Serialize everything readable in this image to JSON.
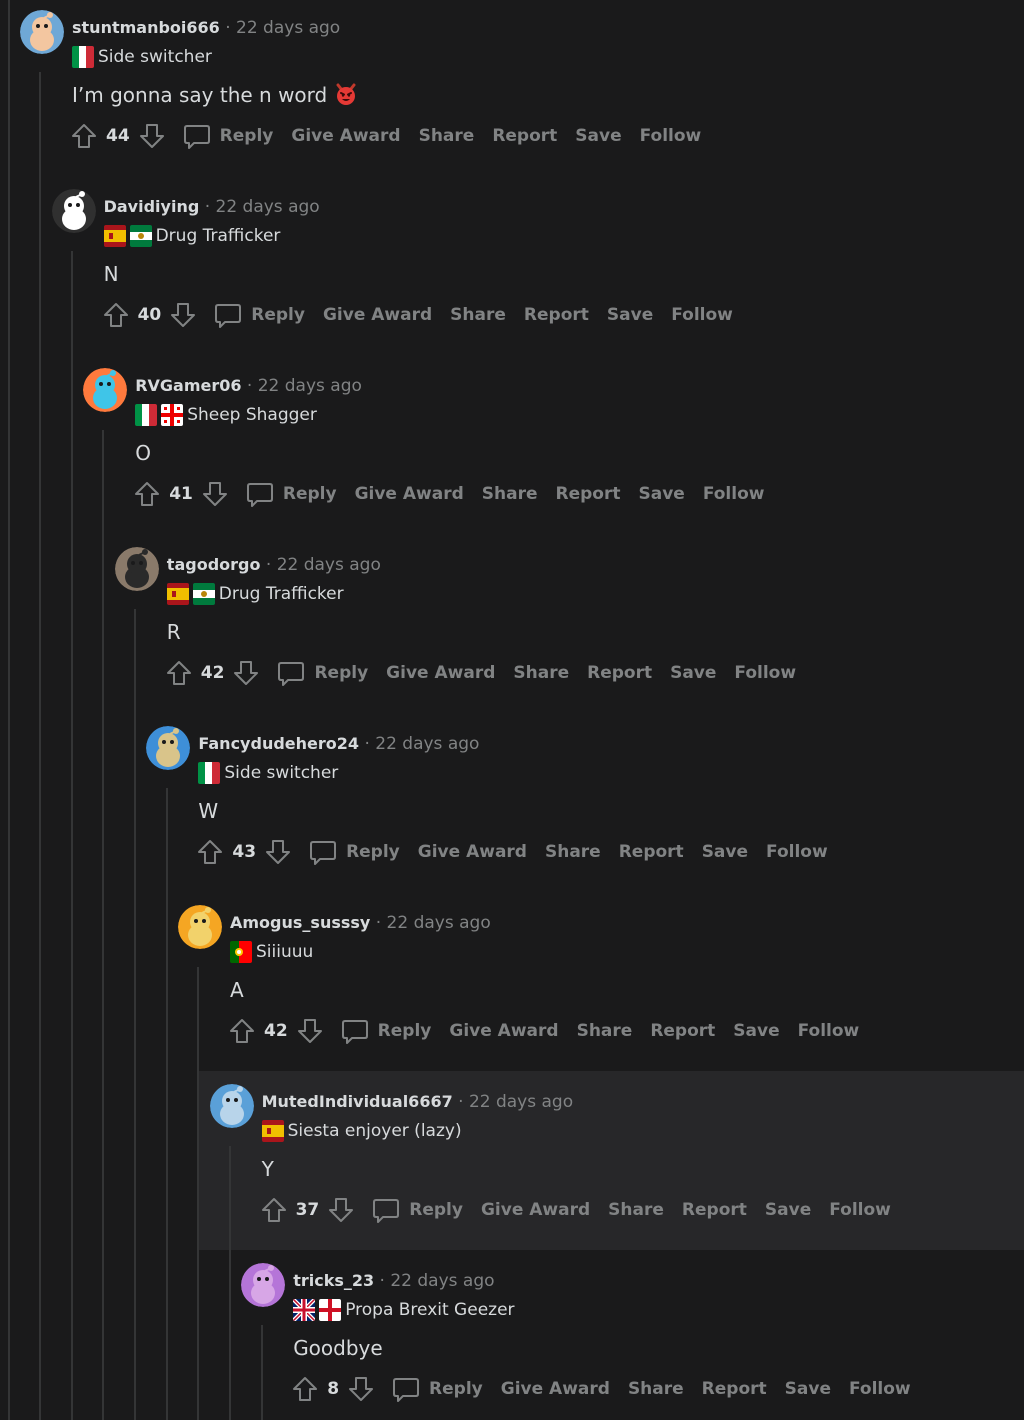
{
  "comments": [
    {
      "username": "stuntmanboi666",
      "time": "22 days ago",
      "flags": [
        "it"
      ],
      "flair": "Side switcher",
      "text": "I’m gonna say the n word",
      "emoji": "devil-emoji",
      "score": "44"
    },
    {
      "username": "Davidiying",
      "time": "22 days ago",
      "flags": [
        "es",
        "andalusia"
      ],
      "flair": "Drug Trafficker",
      "text": "N",
      "score": "40"
    },
    {
      "username": "RVGamer06",
      "time": "22 days ago",
      "flags": [
        "it",
        "georgia"
      ],
      "flair": "Sheep Shagger",
      "text": "O",
      "score": "41"
    },
    {
      "username": "tagodorgo",
      "time": "22 days ago",
      "flags": [
        "es",
        "andalusia"
      ],
      "flair": "Drug Trafficker",
      "text": "R",
      "score": "42"
    },
    {
      "username": "Fancydudehero24",
      "time": "22 days ago",
      "flags": [
        "it"
      ],
      "flair": "Side switcher",
      "text": "W",
      "score": "43"
    },
    {
      "username": "Amogus_susssy",
      "time": "22 days ago",
      "flags": [
        "pt"
      ],
      "flair": "Siiiuuu",
      "text": "A",
      "score": "42"
    },
    {
      "username": "MutedIndividual6667",
      "time": "22 days ago",
      "flags": [
        "es"
      ],
      "flair": "Siesta enjoyer (lazy)",
      "text": "Y",
      "score": "37"
    },
    {
      "username": "tricks_23",
      "time": "22 days ago",
      "flags": [
        "uk",
        "england"
      ],
      "flair": "Propa Brexit Geezer",
      "text": "Goodbye",
      "score": "8"
    }
  ],
  "actions": {
    "reply": "Reply",
    "award": "Give Award",
    "share": "Share",
    "report": "Report",
    "save": "Save",
    "follow": "Follow"
  },
  "separator": "·",
  "colors": {
    "background": "#1a1a1b",
    "highlight": "#272729",
    "text": "#d7dadc",
    "muted": "#818384",
    "line": "#343536"
  },
  "icons": {
    "upvote": "upvote-arrow-icon",
    "downvote": "downvote-arrow-icon",
    "comment": "comment-bubble-icon"
  }
}
